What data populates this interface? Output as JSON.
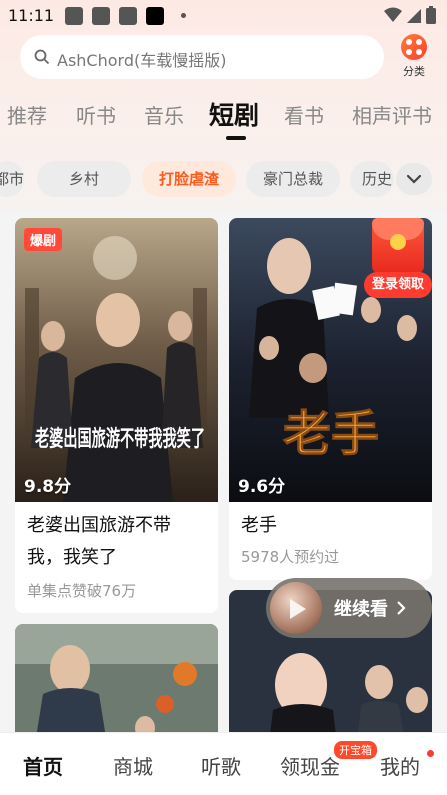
{
  "status": {
    "time": "11:11"
  },
  "search": {
    "placeholder": "AshChord(车载慢摇版)"
  },
  "category": {
    "label": "分类"
  },
  "tabs": [
    "推荐",
    "听书",
    "音乐",
    "短剧",
    "看书",
    "相声评书"
  ],
  "chips": [
    "都市",
    "乡村",
    "打脸虐渣",
    "豪门总裁",
    "历史"
  ],
  "cards": [
    {
      "badge": "爆剧",
      "poster_text": "老婆出国旅游不带我我笑了",
      "rating": "9.8分",
      "title_line1": "老婆出国旅游不带",
      "title_line2": "我，我笑了",
      "sub": "单集点赞破76万"
    },
    {
      "poster_text": "老手",
      "rating": "9.6分",
      "title": "老手",
      "sub": "5978人预约过"
    }
  ],
  "redpack": {
    "label": "登录领取"
  },
  "continue": {
    "label": "继续看"
  },
  "bottom_nav": [
    "首页",
    "商城",
    "听歌",
    "领现金",
    "我的"
  ],
  "bottom_badge": "开宝箱",
  "colors": {
    "accent": "#ff5a1f",
    "red": "#ff3b2f"
  }
}
